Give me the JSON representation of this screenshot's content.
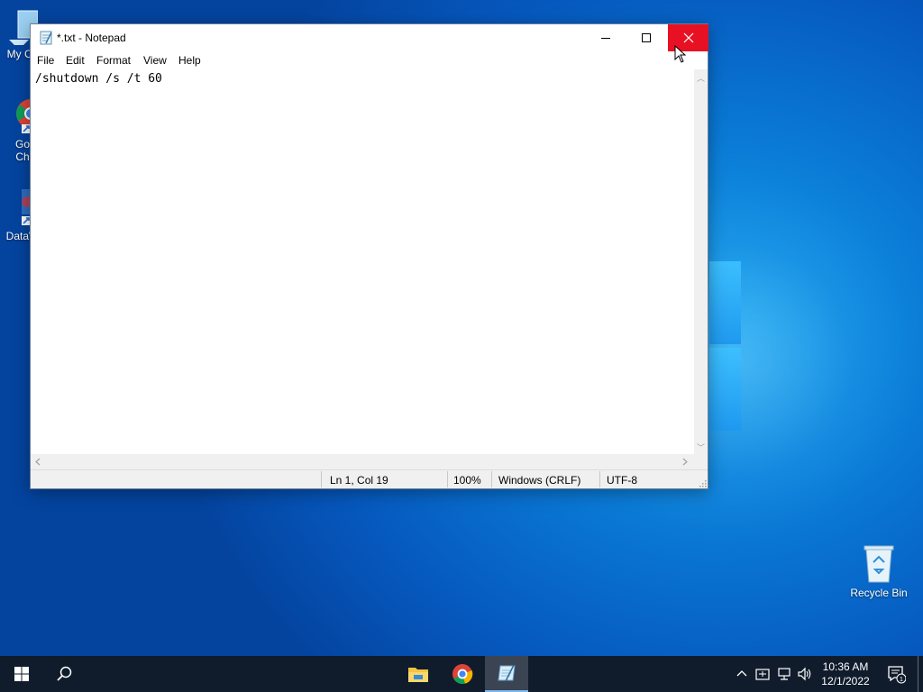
{
  "desktop": {
    "icons": [
      {
        "label": "My Co"
      },
      {
        "label": "Go\nCh"
      },
      {
        "label": "DataW"
      }
    ],
    "recycle_bin": {
      "label": "Recycle Bin"
    }
  },
  "notepad": {
    "title": "*.txt - Notepad",
    "menu": [
      "File",
      "Edit",
      "Format",
      "View",
      "Help"
    ],
    "content": "/shutdown /s /t 60",
    "status": {
      "position": "Ln 1, Col 19",
      "zoom": "100%",
      "line_ending": "Windows (CRLF)",
      "encoding": "UTF-8"
    }
  },
  "taskbar": {
    "clock_time": "10:36 AM",
    "clock_date": "12/1/2022",
    "notification_count": "1"
  },
  "colors": {
    "close_button": "#e81123",
    "taskbar": "#101c2c",
    "desktop_accent": "#0a7ad6"
  }
}
